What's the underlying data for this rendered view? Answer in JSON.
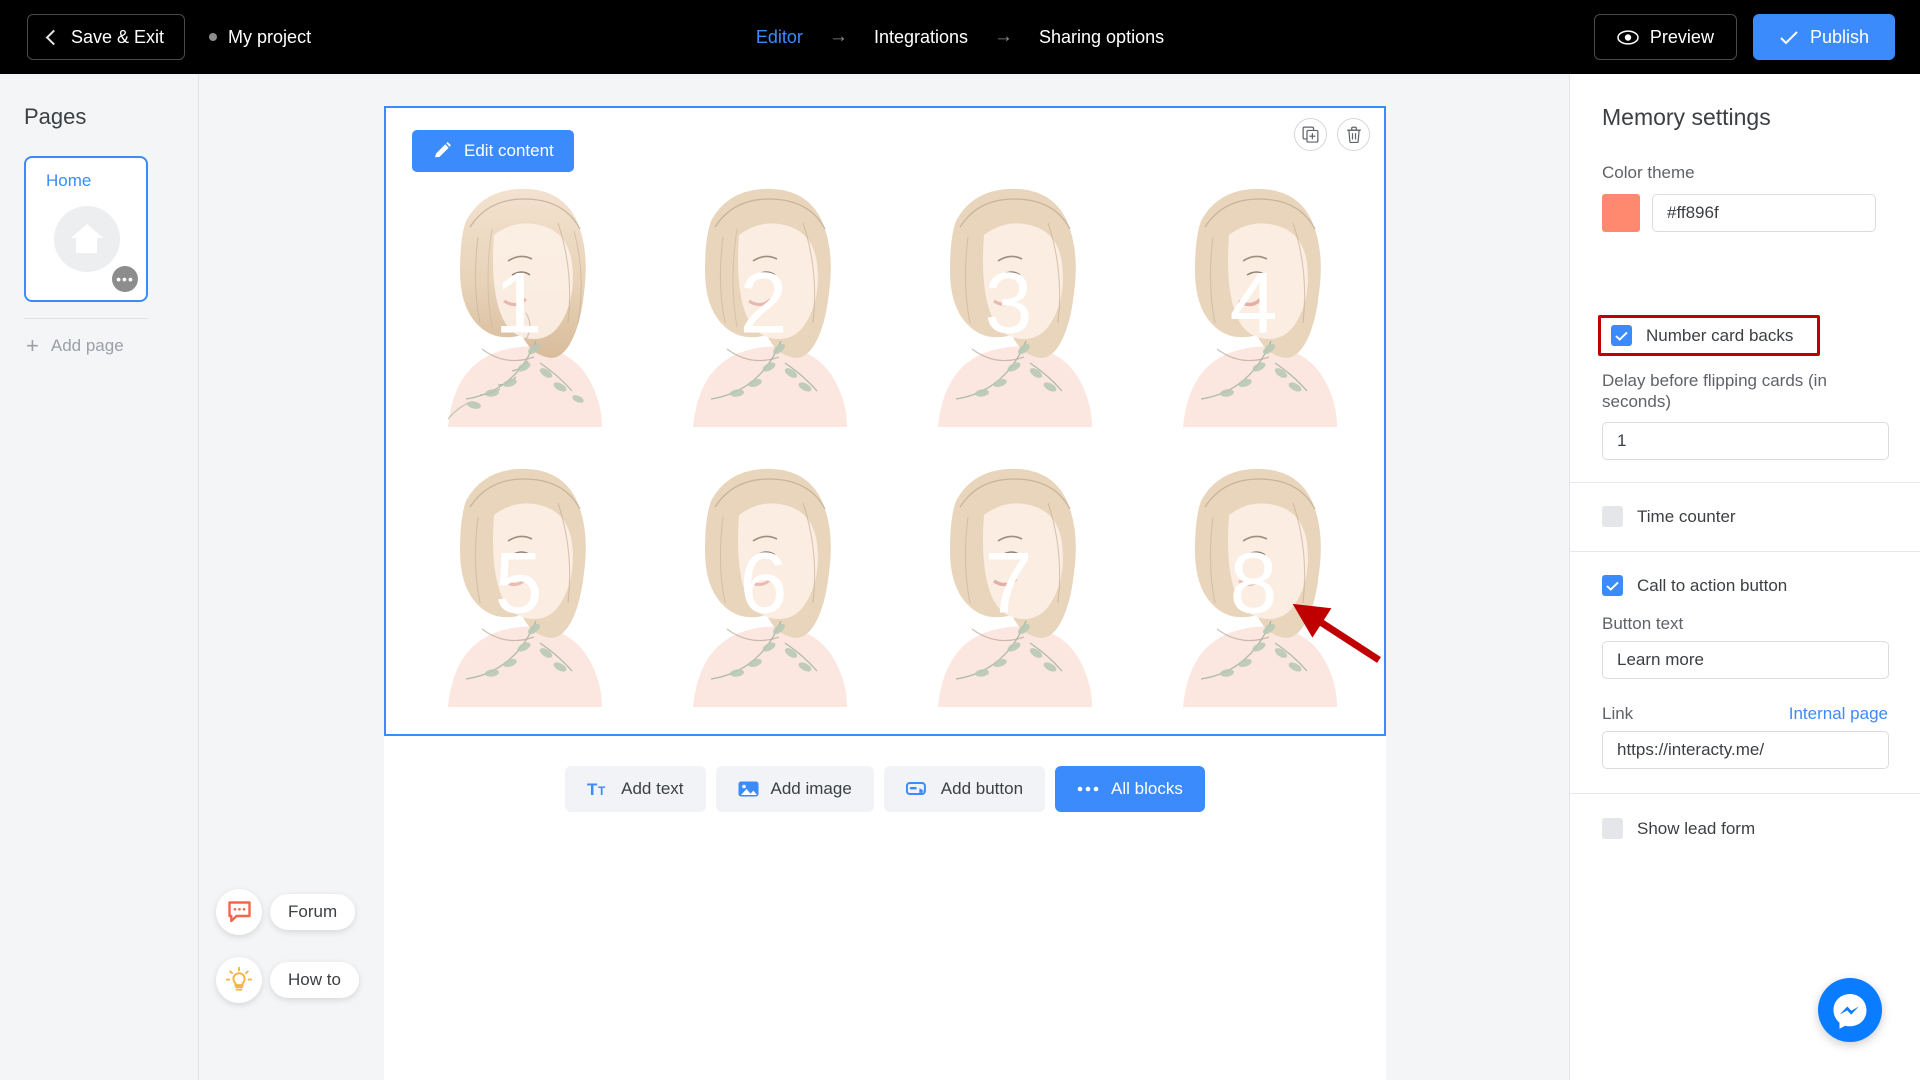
{
  "header": {
    "save_exit": "Save & Exit",
    "project_name": "My project",
    "nav": [
      {
        "label": "Editor",
        "active": true
      },
      {
        "label": "Integrations",
        "active": false
      },
      {
        "label": "Sharing options",
        "active": false
      }
    ],
    "arrow_glyph": "→",
    "preview": "Preview",
    "publish": "Publish",
    "accent_blue": "#3b8bfd"
  },
  "sidebar": {
    "title": "Pages",
    "page_card": {
      "label": "Home",
      "icon": "home-icon",
      "more_glyph": "•••"
    },
    "add_page": "Add page"
  },
  "canvas": {
    "edit_content": "Edit content",
    "tools": [
      {
        "name": "duplicate-icon"
      },
      {
        "name": "delete-icon"
      }
    ],
    "cards": [
      {
        "number": "1"
      },
      {
        "number": "2"
      },
      {
        "number": "3"
      },
      {
        "number": "4"
      },
      {
        "number": "5"
      },
      {
        "number": "6"
      },
      {
        "number": "7"
      },
      {
        "number": "8"
      }
    ],
    "add_toolbar": [
      {
        "label": "Add text",
        "icon": "text-icon",
        "primary": false
      },
      {
        "label": "Add image",
        "icon": "image-icon",
        "primary": false
      },
      {
        "label": "Add button",
        "icon": "button-icon",
        "primary": false
      },
      {
        "label": "All blocks",
        "icon": "dots-icon",
        "primary": true
      }
    ]
  },
  "help": {
    "forum": "Forum",
    "how_to": "How to"
  },
  "settings": {
    "title": "Memory settings",
    "color_theme_label": "Color theme",
    "color_theme_value": "#ff896f",
    "number_card_backs": {
      "label": "Number card backs",
      "checked": true,
      "highlight_color": "#c00000"
    },
    "delay_label": "Delay before flipping cards (in seconds)",
    "delay_value": "1",
    "time_counter": {
      "label": "Time counter",
      "checked": false
    },
    "cta": {
      "label": "Call to action button",
      "checked": true,
      "button_text_label": "Button text",
      "button_text_value": "Learn more",
      "link_label": "Link",
      "link_internal": "Internal page",
      "link_value": "https://interacty.me/"
    },
    "show_lead_form": {
      "label": "Show lead form",
      "checked": false
    }
  },
  "annotation": {
    "arrow_color": "#c00000",
    "points_to": "card-8"
  },
  "messenger": {
    "icon": "messenger-icon"
  }
}
